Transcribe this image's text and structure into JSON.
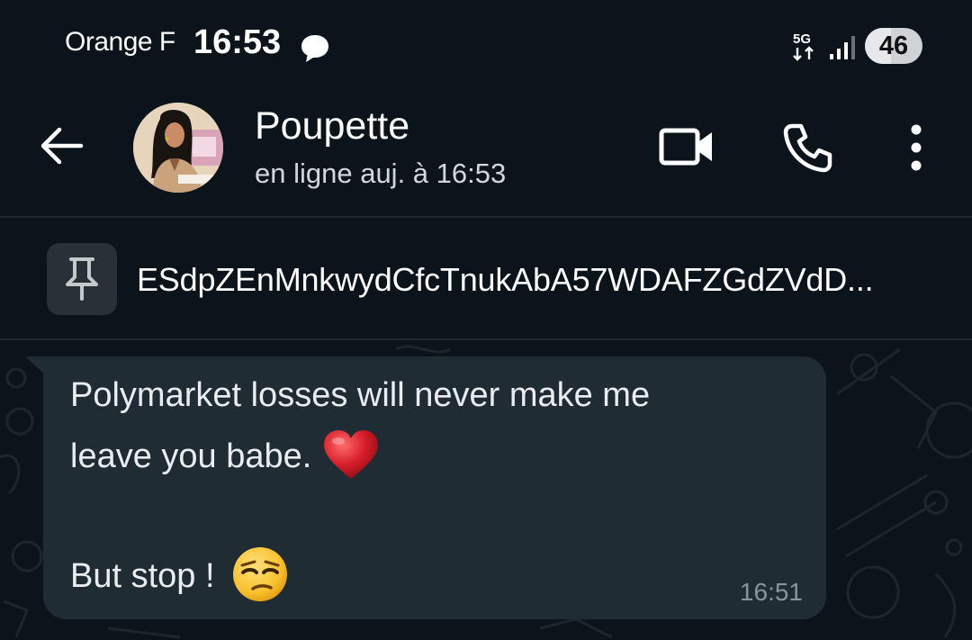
{
  "status_bar": {
    "carrier": "Orange F",
    "time": "16:53",
    "network": "5G",
    "battery": "46",
    "battery_level": 0.46
  },
  "header": {
    "contact_name": "Poupette",
    "contact_status": "en ligne auj. à 16:53",
    "icons": [
      "back-arrow-icon",
      "video-camera-icon",
      "phone-icon",
      "more-vertical-icon"
    ]
  },
  "pinned": {
    "icon": "pin-icon",
    "text": "ESdpZEnMnkwydCfcTnukAbA57WDAFZGdZVdD..."
  },
  "message": {
    "line1": "Polymarket losses will never make me",
    "line2": "leave you babe.",
    "line3": "But stop !",
    "time": "16:51",
    "emojis": [
      "heart-emoji",
      "unamused-face-emoji"
    ]
  },
  "colors": {
    "background": "#0b141a",
    "bubble": "#202c33",
    "text": "#e9edef",
    "muted": "#8696a0"
  }
}
